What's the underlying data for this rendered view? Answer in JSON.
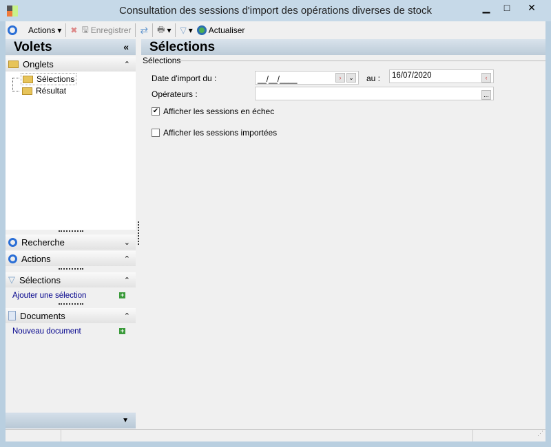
{
  "window": {
    "title": "Consultation des sessions d'import des opérations diverses de stock",
    "minimize": "▁",
    "maximize": "□",
    "close": "✕"
  },
  "toolbar": {
    "actions": "Actions",
    "save": "Enregistrer",
    "refresh": "Actualiser"
  },
  "left": {
    "title": "Volets",
    "collapse": "«",
    "tabs_section": "Onglets",
    "tree": [
      "Sélections",
      "Résultat"
    ],
    "sections": [
      {
        "label": "Recherche"
      },
      {
        "label": "Actions"
      },
      {
        "label": "Sélections",
        "link": "Ajouter une sélection"
      },
      {
        "label": "Documents",
        "link": "Nouveau document"
      }
    ]
  },
  "main": {
    "title": "Sélections",
    "group": "Sélections",
    "date_label": "Date d'import du :",
    "date_from": "__/__/____",
    "au_label": "au :",
    "date_to": "16/07/2020",
    "operators_label": "Opérateurs :",
    "operators_value": "",
    "browse": "...",
    "checkbox_failed": {
      "label": "Afficher les sessions en échec",
      "checked": true
    },
    "checkbox_imported": {
      "label": "Afficher les sessions importées",
      "checked": false
    }
  }
}
